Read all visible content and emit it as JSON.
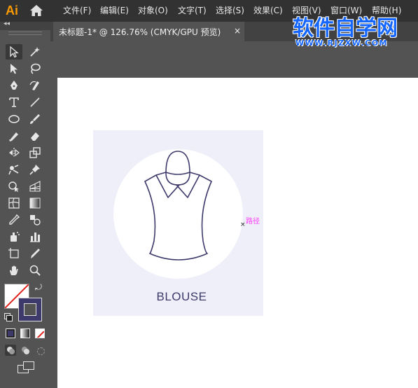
{
  "app": {
    "logo": "Ai"
  },
  "menu": [
    "文件(F)",
    "编辑(E)",
    "对象(O)",
    "文字(T)",
    "选择(S)",
    "效果(C)",
    "视图(V)",
    "窗口(W)",
    "帮助(H)"
  ],
  "watermark": {
    "title": "软件自学网",
    "url": "WWW.RJZXW.COM"
  },
  "tab": {
    "title": "未标题-1* @ 126.76% (CMYK/GPU 预览)",
    "close": "×"
  },
  "canvas": {
    "label": "BLOUSE",
    "path_hint": "路径"
  },
  "colors": {
    "accent": "#3d3a6b",
    "card_bg": "#efeff9",
    "path_hint": "#ff3cff"
  }
}
